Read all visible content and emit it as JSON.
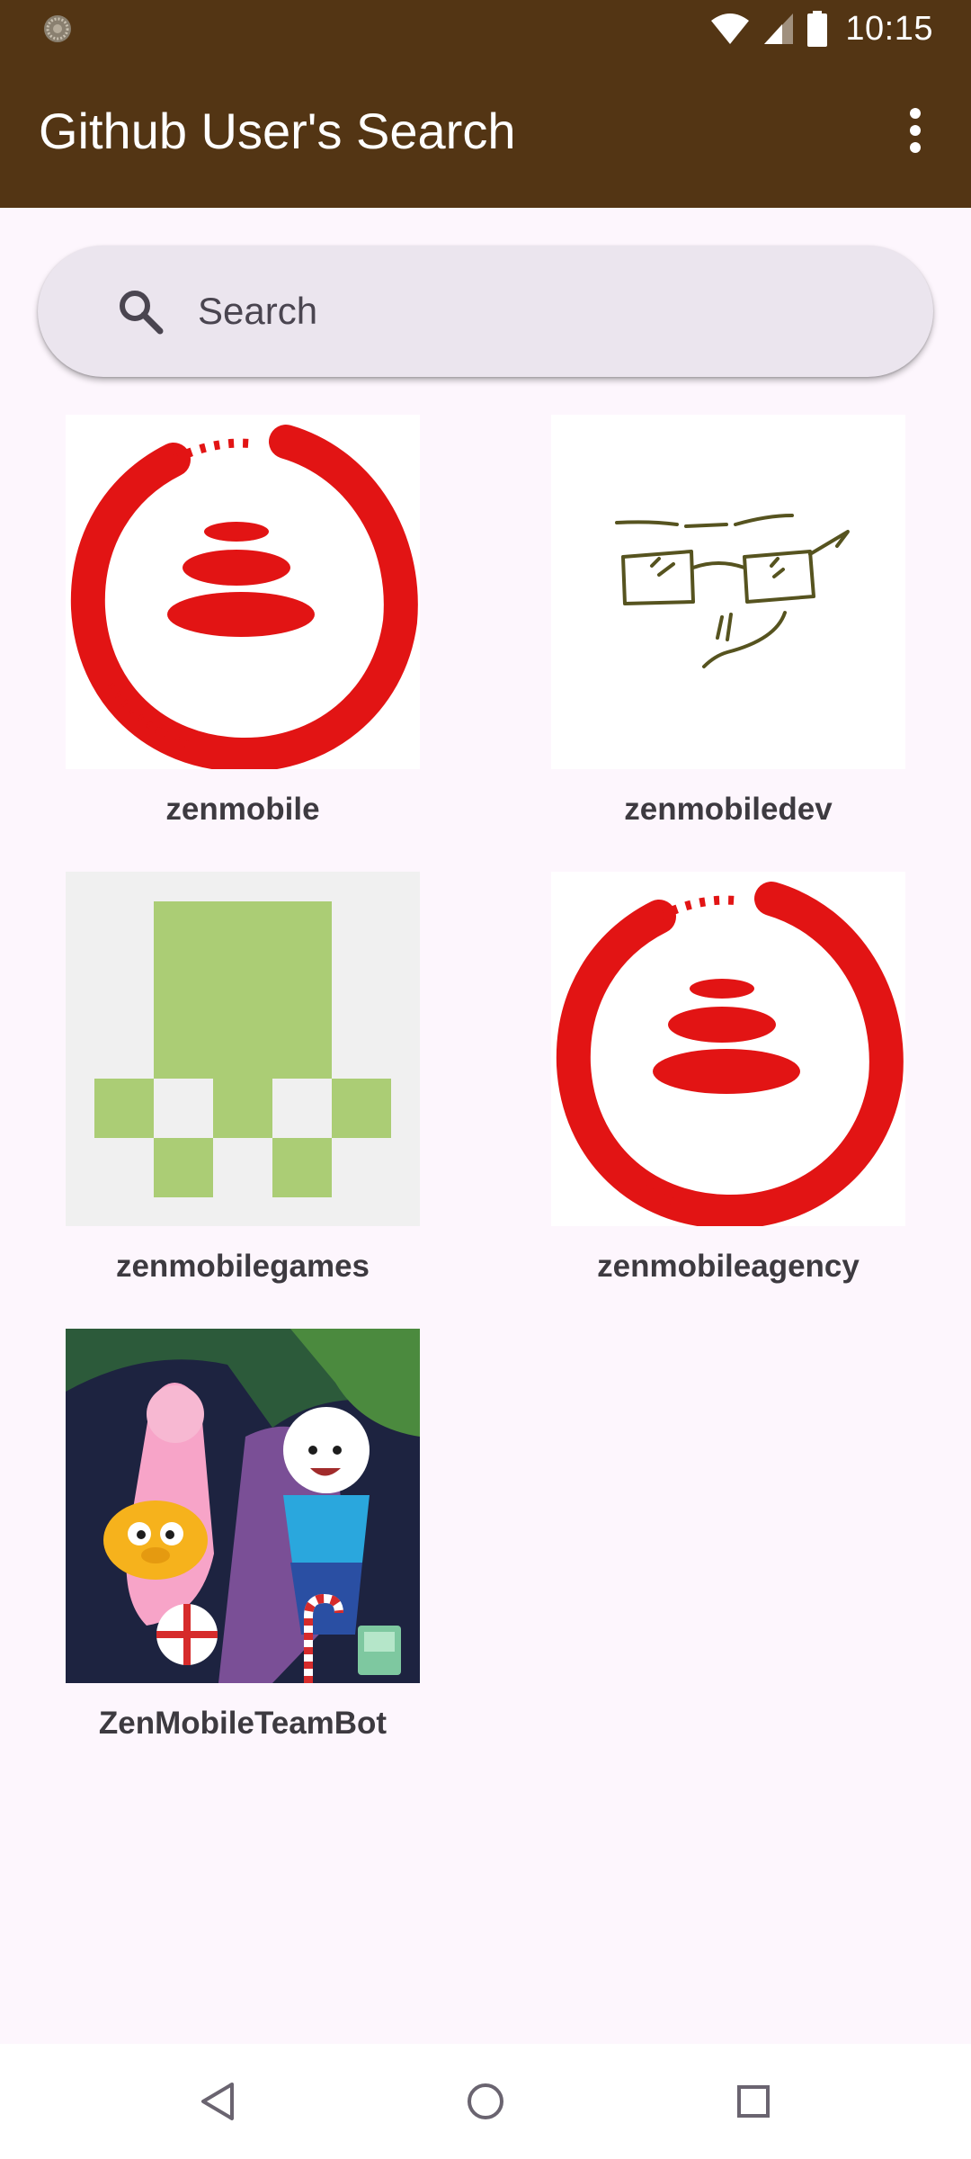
{
  "status_bar": {
    "time": "10:15",
    "icons": [
      "notification-icon",
      "wifi-icon",
      "cell-signal-icon",
      "battery-icon"
    ]
  },
  "app_bar": {
    "title": "Github User's Search",
    "menu_icon": "more-vert-icon",
    "background_color": "#533514"
  },
  "search": {
    "placeholder": "Search",
    "value": "",
    "icon": "search-icon"
  },
  "users": [
    {
      "login": "zenmobile",
      "avatar": "zen-enso-logo"
    },
    {
      "login": "zenmobiledev",
      "avatar": "glasses-sketch"
    },
    {
      "login": "zenmobilegames",
      "avatar": "green-identicon"
    },
    {
      "login": "zenmobileagency",
      "avatar": "zen-enso-logo"
    },
    {
      "login": "ZenMobileTeamBot",
      "avatar": "cartoon-illustration"
    }
  ],
  "navigation": {
    "back_icon": "back-triangle-icon",
    "home_icon": "home-circle-icon",
    "recents_icon": "recents-square-icon"
  },
  "colors": {
    "primary": "#533514",
    "surface": "#fdf6fd",
    "search_container": "#ebe5ee",
    "enso_red": "#e21414",
    "identicon_green": "#abcd75"
  }
}
